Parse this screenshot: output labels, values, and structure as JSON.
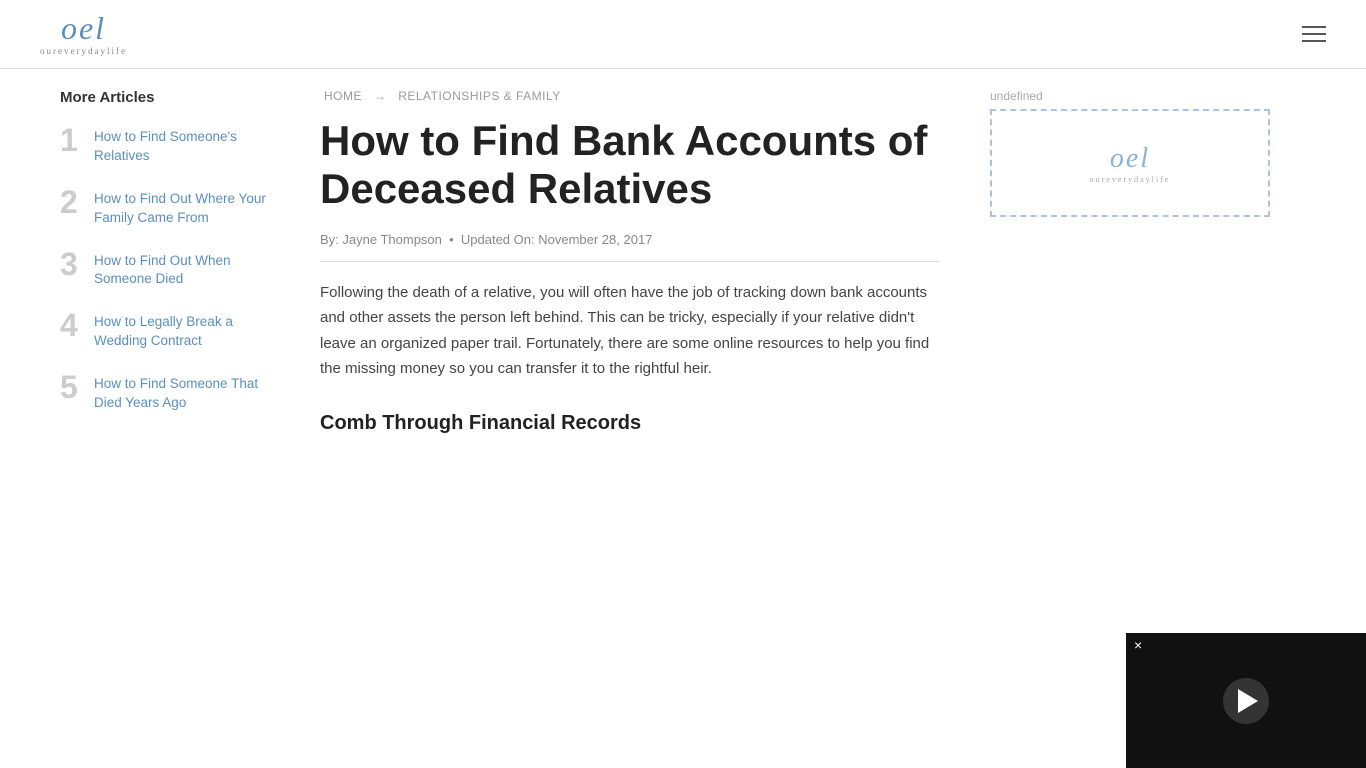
{
  "header": {
    "logo_text": "oel",
    "logo_sub": "oureverydaylife",
    "menu_icon": "hamburger-icon"
  },
  "breadcrumb": {
    "home": "HOME",
    "arrow": "→",
    "section": "RELATIONSHIPS & FAMILY"
  },
  "article": {
    "title": "How to Find Bank Accounts of Deceased Relatives",
    "meta_by": "By: Jayne Thompson",
    "meta_updated": "Updated On: November 28, 2017",
    "body": "Following the death of a relative, you will often have the job of tracking down bank accounts and other assets the person left behind. This can be tricky, especially if your relative didn't leave an organized paper trail. Fortunately, there are some online resources to help you find the missing money so you can transfer it to the rightful heir.",
    "section_heading": "Comb Through Financial Records"
  },
  "sidebar": {
    "title": "More Articles",
    "items": [
      {
        "number": "1",
        "label": "How to Find Someone's Relatives",
        "href": "#"
      },
      {
        "number": "2",
        "label": "How to Find Out Where Your Family Came From",
        "href": "#"
      },
      {
        "number": "3",
        "label": "How to Find Out When Someone Died",
        "href": "#"
      },
      {
        "number": "4",
        "label": "How to Legally Break a Wedding Contract",
        "href": "#"
      },
      {
        "number": "5",
        "label": "How to Find Someone That Died Years Ago",
        "href": "#"
      }
    ]
  },
  "ad": {
    "label": "undefined",
    "logo_text": "oel",
    "logo_sub": "oureverydaylife"
  },
  "video": {
    "close_label": "×"
  }
}
